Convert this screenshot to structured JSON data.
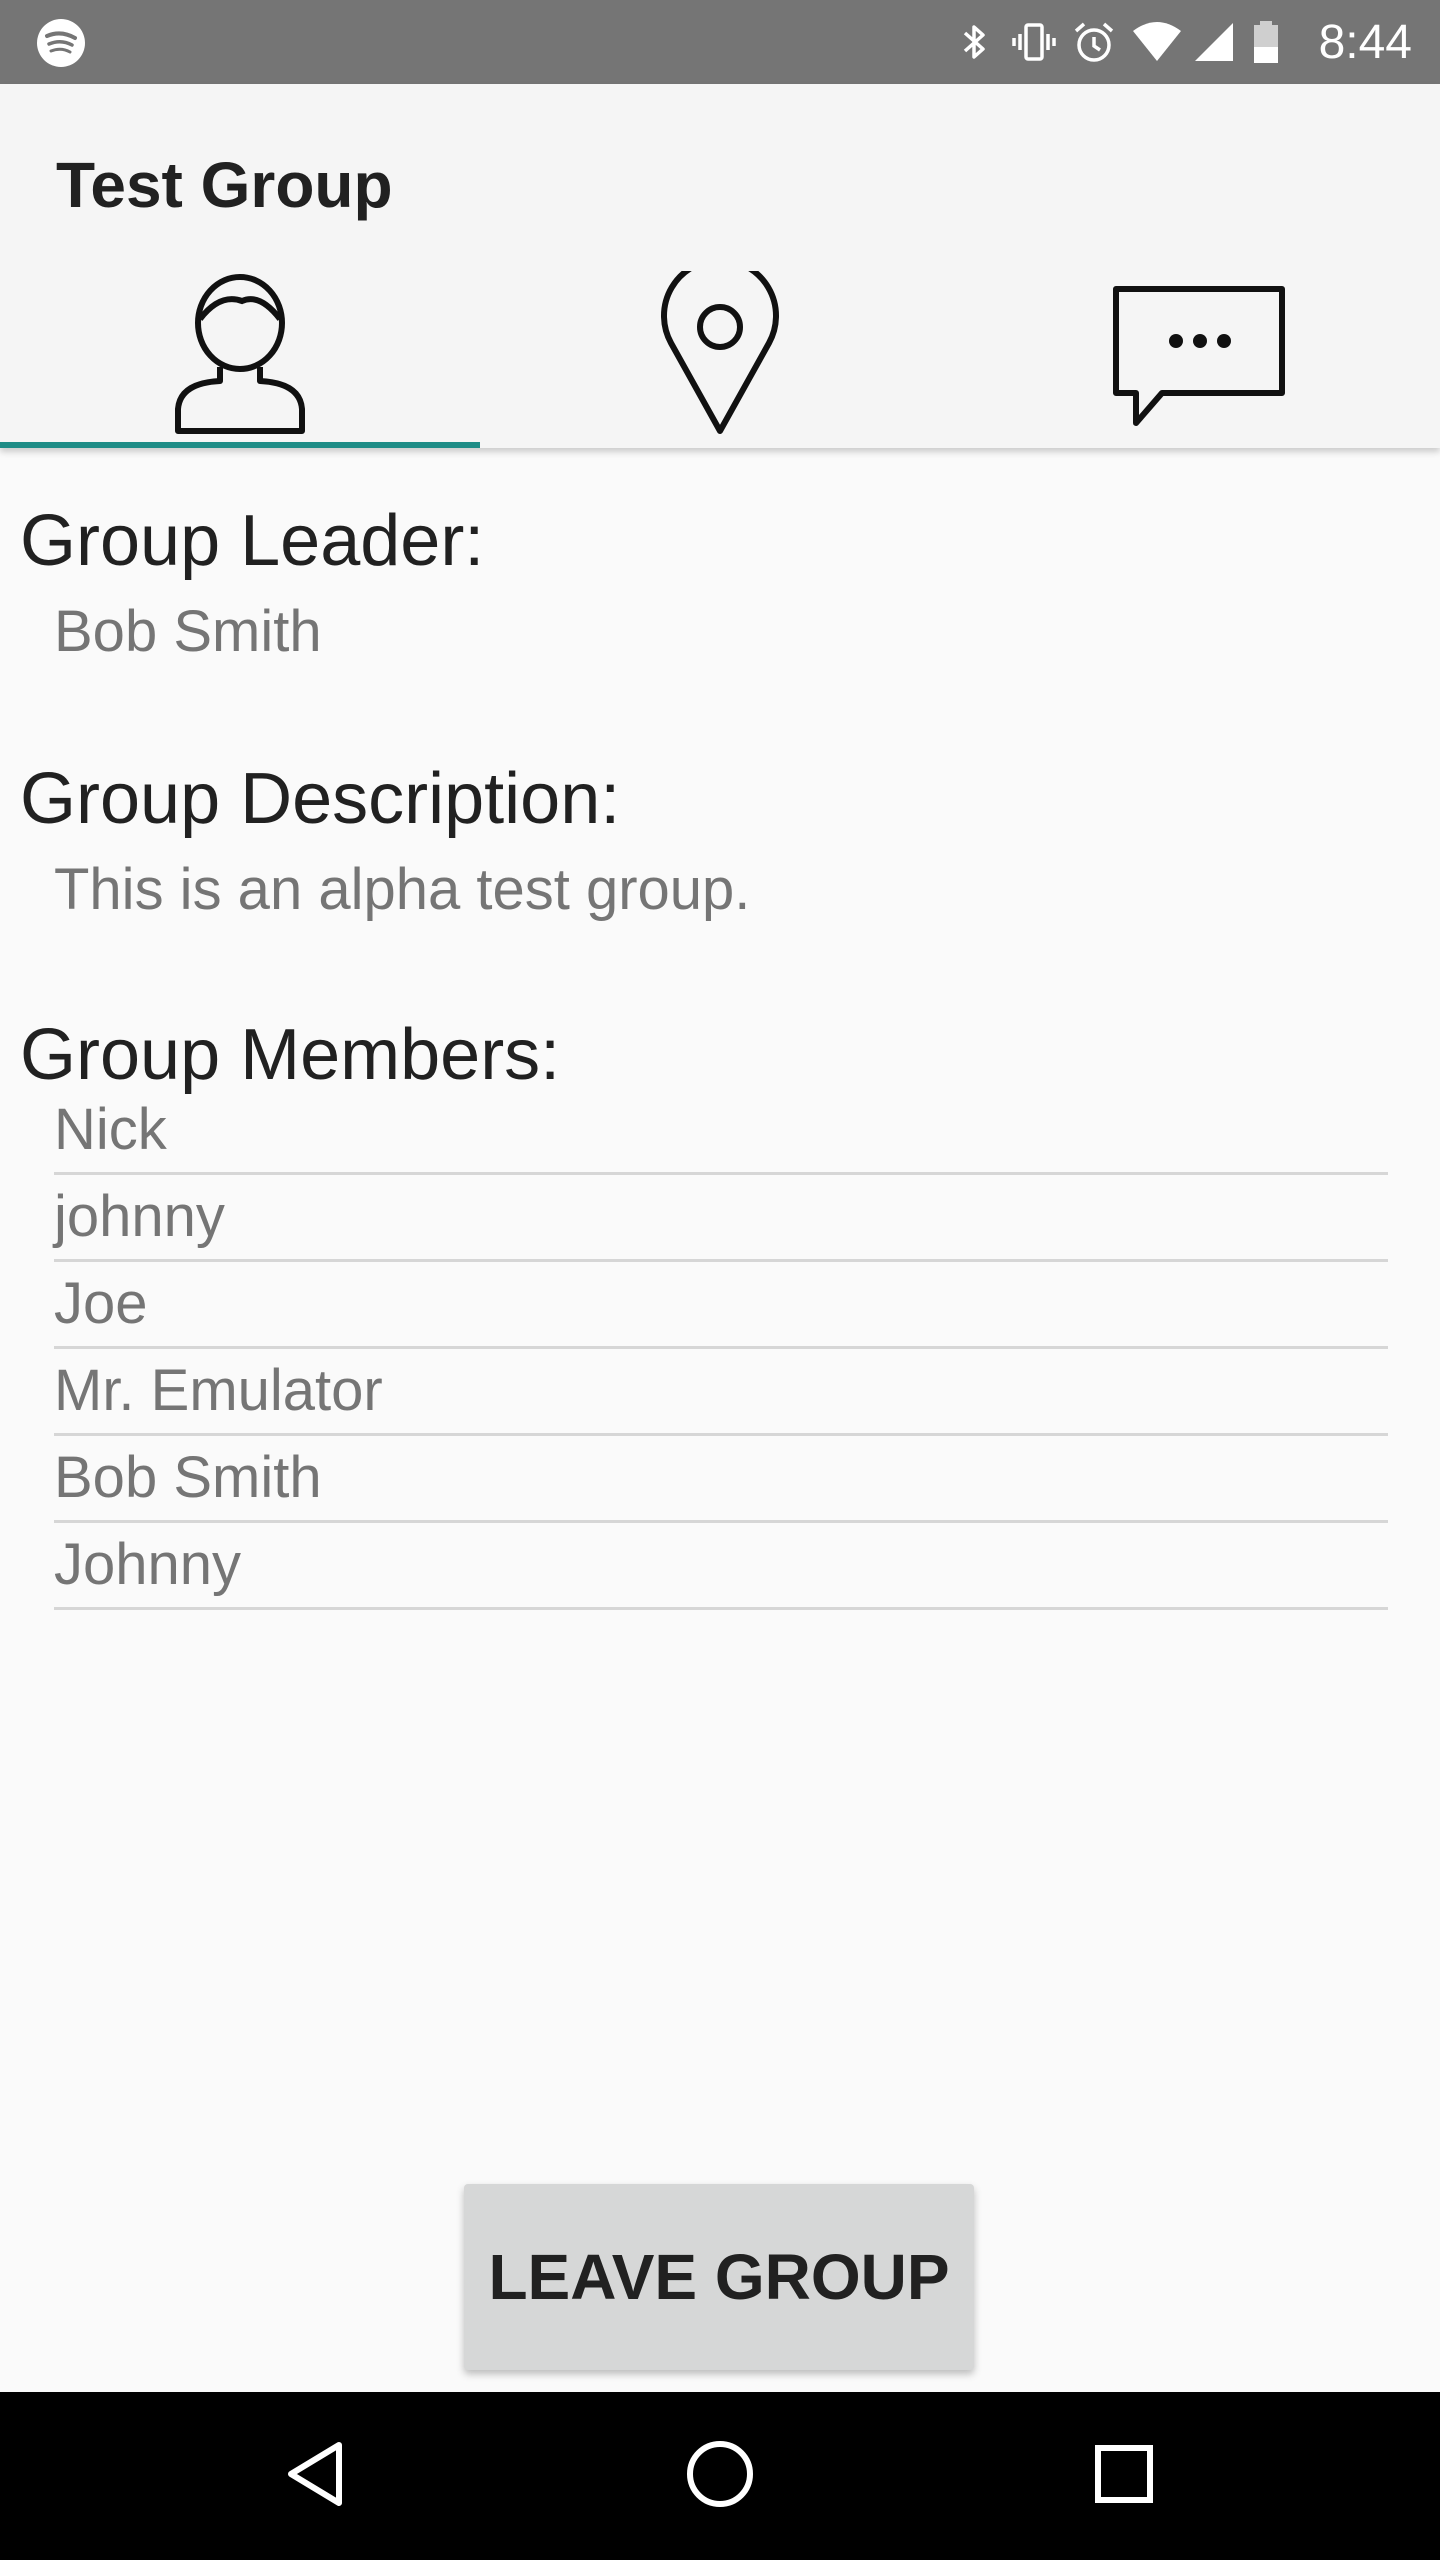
{
  "status_bar": {
    "time": "8:44",
    "icons": [
      "spotify-icon",
      "bluetooth-icon",
      "vibrate-icon",
      "alarm-icon",
      "wifi-icon",
      "signal-icon",
      "battery-icon"
    ]
  },
  "app_bar": {
    "title": "Test Group",
    "tabs": [
      {
        "icon": "person-icon",
        "selected": true
      },
      {
        "icon": "location-pin-icon",
        "selected": false
      },
      {
        "icon": "chat-bubble-icon",
        "selected": false
      }
    ],
    "indicator_color": "#1e8c86"
  },
  "content": {
    "leader_label": "Group Leader:",
    "leader_value": "Bob Smith",
    "description_label": "Group Description:",
    "description_value": "This is an alpha test group.",
    "members_label": "Group Members:",
    "members": [
      "Nick",
      "johnny",
      "Joe",
      "Mr. Emulator",
      "Bob Smith",
      "Johnny"
    ]
  },
  "actions": {
    "leave_label": "LEAVE GROUP"
  },
  "nav_bar": {
    "buttons": [
      "back-icon",
      "home-icon",
      "recents-icon"
    ]
  }
}
